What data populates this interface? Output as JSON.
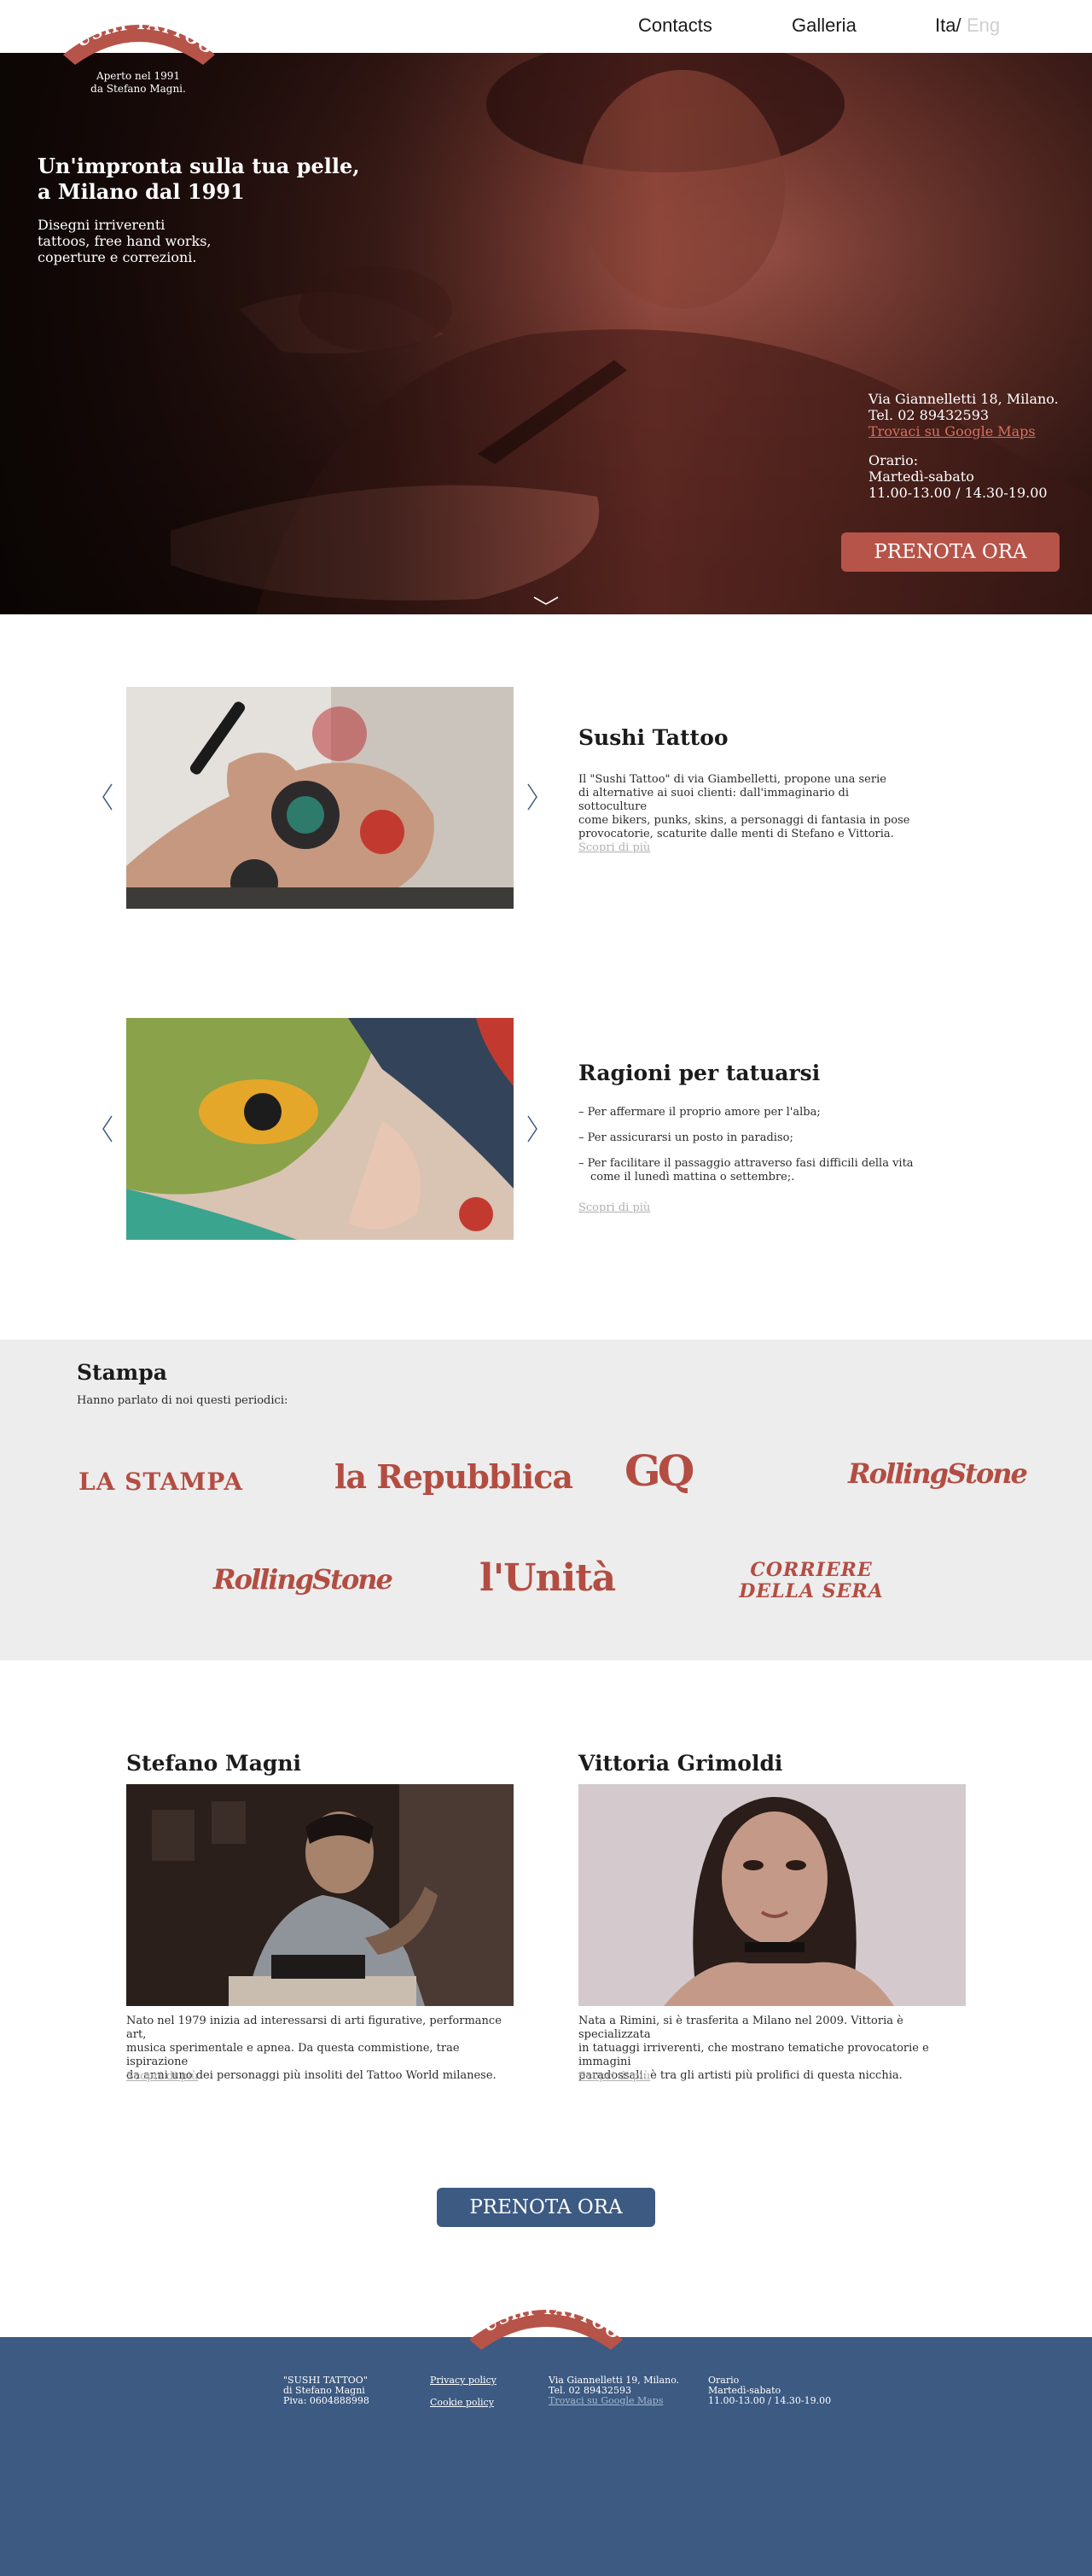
{
  "brand": {
    "logo_text": "SUSHI TATTOO",
    "tagline_line1": "Aperto nel 1991",
    "tagline_line2": "da Stefano Magni."
  },
  "nav": {
    "contacts": "Contacts",
    "galleria": "Galleria",
    "lang_ita": "Ita/",
    "lang_eng": "Eng"
  },
  "hero": {
    "title_line1": "Un'impronta sulla tua pelle,",
    "title_line2": "a Milano dal 1991",
    "sub_line1": "Disegni irriverenti",
    "sub_line2": "tattoos, free hand works,",
    "sub_line3": "coperture e correzioni.",
    "address": "Via Giannelletti 18, Milano.",
    "phone": "Tel. 02 89432593",
    "map_link": "Trovaci su Google Maps",
    "hours_label": "Orario:",
    "days": "Martedì-sabato",
    "hours": "11.00-13.00 / 14.30-19.00",
    "book_button": "PRENOTA ORA"
  },
  "about": {
    "title": "Sushi Tattoo",
    "text_line1": "Il \"Sushi Tattoo\" di via Giambelletti, propone una serie",
    "text_line2": "di alternative ai suoi clienti: dall'immaginario di sottoculture",
    "text_line3": "come bikers, punks, skins, a personaggi di fantasia in pose",
    "text_line4": "provocatorie, scaturite dalle menti di Stefano e Vittoria.",
    "more": "Scopri di più"
  },
  "reasons": {
    "title": "Ragioni per tatuarsi",
    "items": [
      "– Per affermare il proprio amore per l'alba;",
      "– Per assicurarsi un posto in paradiso;",
      "– Per facilitare il passaggio attraverso fasi difficili della vita come il lunedì mattina o settembre;."
    ],
    "more": "Scopri di più"
  },
  "press": {
    "title": "Stampa",
    "subtitle": "Hanno parlato di noi questi periodici:",
    "logos": [
      "LA STAMPA",
      "la Repubblica",
      "GQ",
      "RollingStone",
      "RollingStone",
      "l'Unità",
      "CORRIERE",
      "DELLA SERA"
    ]
  },
  "artists": [
    {
      "name": "Stefano Magni",
      "text_line1": "Nato nel 1979 inizia ad interessarsi di arti figurative, performance art,",
      "text_line2": "musica sperimentale e apnea. Da questa commistione, trae ispirazione",
      "text_line3": "da anni uno dei personaggi più insoliti del Tattoo World milanese.",
      "more": "Scopri di più"
    },
    {
      "name": "Vittoria Grimoldi",
      "text_line1": "Nata a Rimini, si è trasferita a Milano nel 2009. Vittoria è specializzata",
      "text_line2": "in tatuaggi irriverenti, che mostrano tematiche provocatorie e immagini",
      "text_line3": "paradossali: è tra gli artisti più prolifici di questa nicchia.",
      "more": "Scopri di più"
    }
  ],
  "cta": {
    "book_button": "PRENOTA ORA"
  },
  "footer": {
    "logo_text": "SUSHI TATTOO",
    "company_line1": "\"SUSHI TATTOO\"",
    "company_line2": "di Stefano Magni",
    "company_line3": "Piva: 0604888998",
    "privacy": "Privacy policy",
    "cookie": "Cookie policy",
    "address": "Via Giannelletti 19, Milano.",
    "phone": "Tel. 02 89432593",
    "map_link": "Trovaci su Google Maps",
    "hours_label": "Orario",
    "days": "Martedì-sabato",
    "hours": "11.00-13.00 / 14.30-19.00"
  },
  "colors": {
    "brand_red": "#b65449",
    "brand_blue": "#3c5a82",
    "press_bg": "#ededed"
  },
  "icons": [
    "chevron-left-icon",
    "chevron-right-icon",
    "chevron-down-icon"
  ]
}
